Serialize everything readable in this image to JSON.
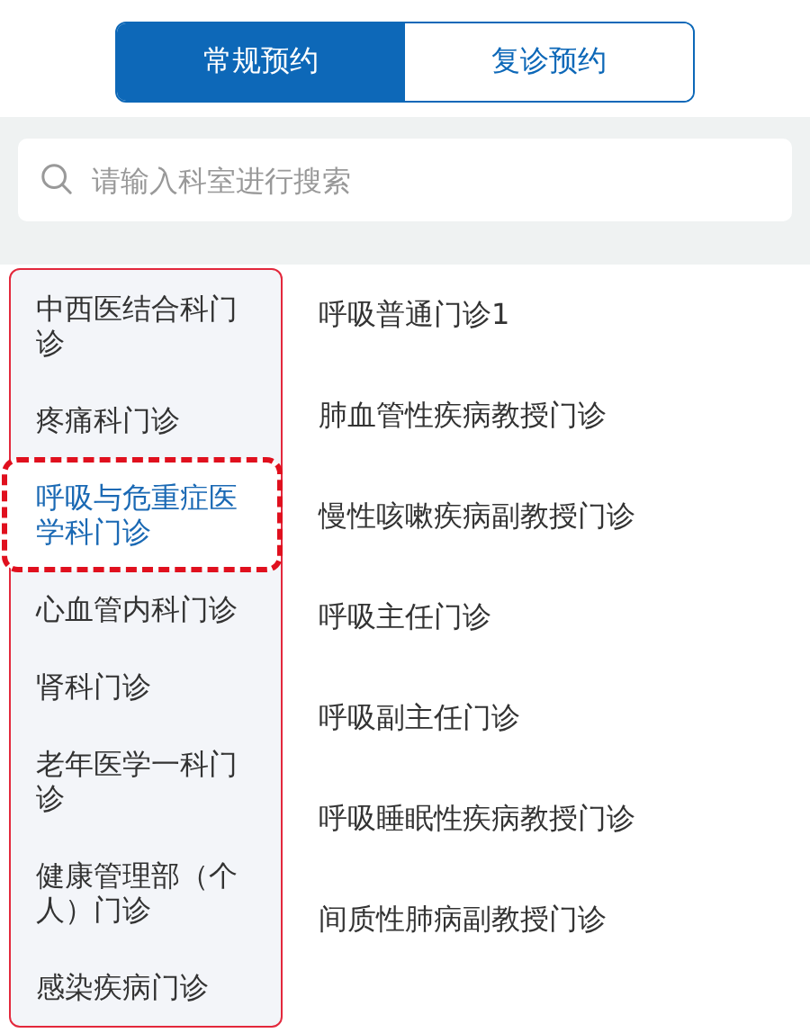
{
  "tabs": [
    {
      "label": "常规预约",
      "selected": true
    },
    {
      "label": "复诊预约",
      "selected": false
    }
  ],
  "search": {
    "placeholder": "请输入科室进行搜索"
  },
  "departments": [
    {
      "label": "中西医结合科门诊",
      "selected": false
    },
    {
      "label": "疼痛科门诊",
      "selected": false
    },
    {
      "label": "呼吸与危重症医学科门诊",
      "selected": true
    },
    {
      "label": "心血管内科门诊",
      "selected": false
    },
    {
      "label": "肾科门诊",
      "selected": false
    },
    {
      "label": "老年医学一科门诊",
      "selected": false
    },
    {
      "label": "健康管理部（个人）门诊",
      "selected": false
    },
    {
      "label": "感染疾病门诊",
      "selected": false
    }
  ],
  "clinics": [
    "呼吸普通门诊1",
    "肺血管性疾病教授门诊",
    "慢性咳嗽疾病副教授门诊",
    "呼吸主任门诊",
    "呼吸副主任门诊",
    "呼吸睡眠性疾病教授门诊",
    "间质性肺病副教授门诊"
  ]
}
